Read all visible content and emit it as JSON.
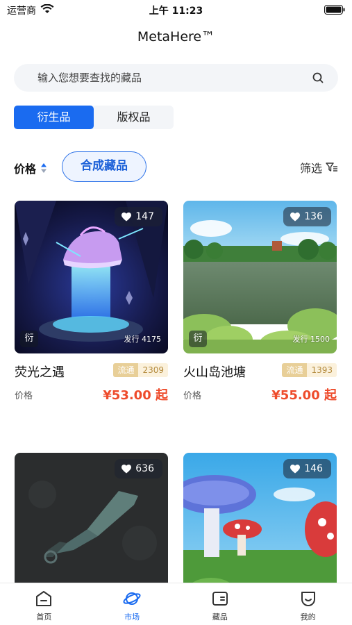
{
  "status_bar": {
    "carrier": "运营商",
    "time": "上午 11:23"
  },
  "app": {
    "title": "MetaHere™"
  },
  "search": {
    "placeholder": "输入您想要查找的藏品"
  },
  "segment": {
    "tabs": [
      "衍生品",
      "版权品"
    ],
    "active_index": 0
  },
  "filters": {
    "price_label": "价格",
    "combine_label": "合成藏品",
    "filter_label": "筛选"
  },
  "cards": [
    {
      "name": "荧光之遇",
      "likes": "147",
      "badge": "衍",
      "issue": "发行 4175",
      "circ_label": "流通",
      "circ_value": "2309",
      "price_label": "价格",
      "price": "¥53.00 起"
    },
    {
      "name": "火山岛池塘",
      "likes": "136",
      "badge": "衍",
      "issue": "发行 1500",
      "circ_label": "流通",
      "circ_value": "1393",
      "price_label": "价格",
      "price": "¥55.00 起"
    },
    {
      "name": "",
      "likes": "636"
    },
    {
      "name": "",
      "likes": "146"
    }
  ],
  "tabbar": {
    "items": [
      "首页",
      "市场",
      "藏品",
      "我的"
    ],
    "active_index": 1
  },
  "colors": {
    "accent": "#1a6bf0",
    "price": "#ee4b2b",
    "circ_badge": "#e8cf98"
  }
}
